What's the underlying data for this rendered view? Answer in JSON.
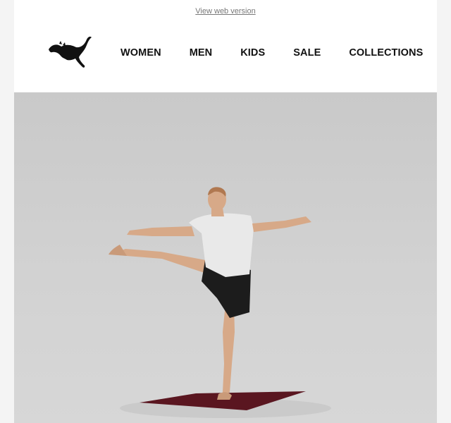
{
  "topbar": {
    "view_web_version": "View web version"
  },
  "brand": {
    "logo_icon": "puma-logo-icon"
  },
  "nav": {
    "items": [
      {
        "label": "WOMEN"
      },
      {
        "label": "MEN"
      },
      {
        "label": "KIDS"
      },
      {
        "label": "SALE"
      },
      {
        "label": "COLLECTIONS"
      }
    ]
  },
  "hero": {
    "image": "yoga-standing-pose-photo"
  },
  "colors": {
    "background": "#f4f4f4",
    "hero_bg": "#cfcfcf",
    "mat": "#5a1620",
    "text": "#111111"
  }
}
